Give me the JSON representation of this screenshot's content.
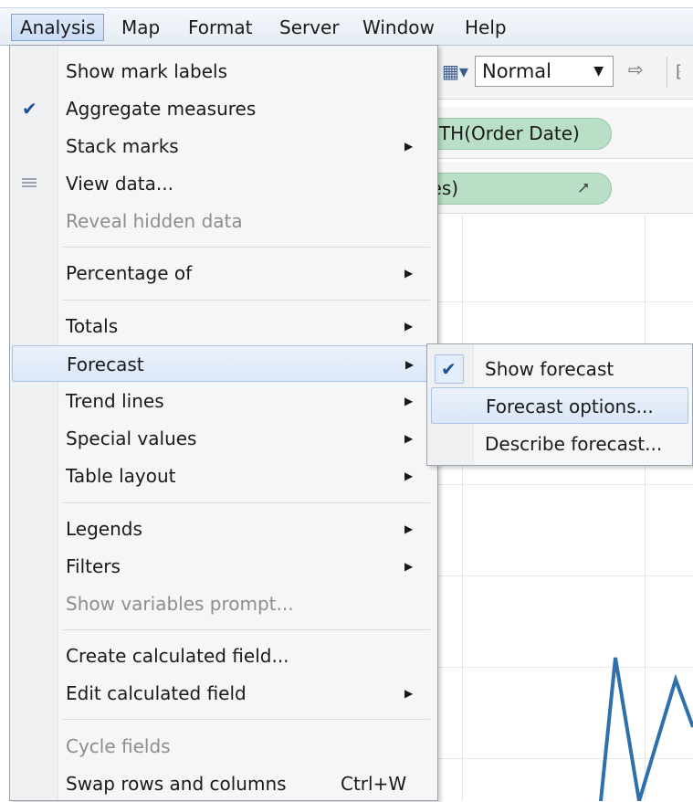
{
  "menubar": {
    "items": [
      "Analysis",
      "Map",
      "Format",
      "Server",
      "Window",
      "Help"
    ],
    "active": "Analysis"
  },
  "toolbar": {
    "view_size": "Normal"
  },
  "shelves": {
    "columns_pill": "NTH(Order Date)",
    "rows_pill": "les)"
  },
  "analysis_menu": {
    "show_mark_labels": "Show mark labels",
    "aggregate_measures": "Aggregate measures",
    "stack_marks": "Stack marks",
    "view_data": "View data...",
    "reveal_hidden_data": "Reveal hidden data",
    "percentage_of": "Percentage of",
    "totals": "Totals",
    "forecast": "Forecast",
    "trend_lines": "Trend lines",
    "special_values": "Special values",
    "table_layout": "Table layout",
    "legends": "Legends",
    "filters": "Filters",
    "show_variables_prompt": "Show variables prompt...",
    "create_calculated_field": "Create calculated field...",
    "edit_calculated_field": "Edit calculated field",
    "cycle_fields": "Cycle fields",
    "swap_rows_and_columns": "Swap rows and columns",
    "swap_shortcut": "Ctrl+W"
  },
  "forecast_submenu": {
    "show_forecast": "Show forecast",
    "forecast_options": "Forecast options...",
    "describe_forecast": "Describe forecast..."
  },
  "colors": {
    "pill_green": "#b9dfc6",
    "highlight_blue": "#dbe7f7",
    "line_blue": "#2f6fab",
    "check_blue": "#1f4f9c"
  },
  "icons": {
    "check": "checkmark-icon",
    "view_data": "table-grid-icon",
    "submenu_arrow": "triangle-right-icon"
  }
}
